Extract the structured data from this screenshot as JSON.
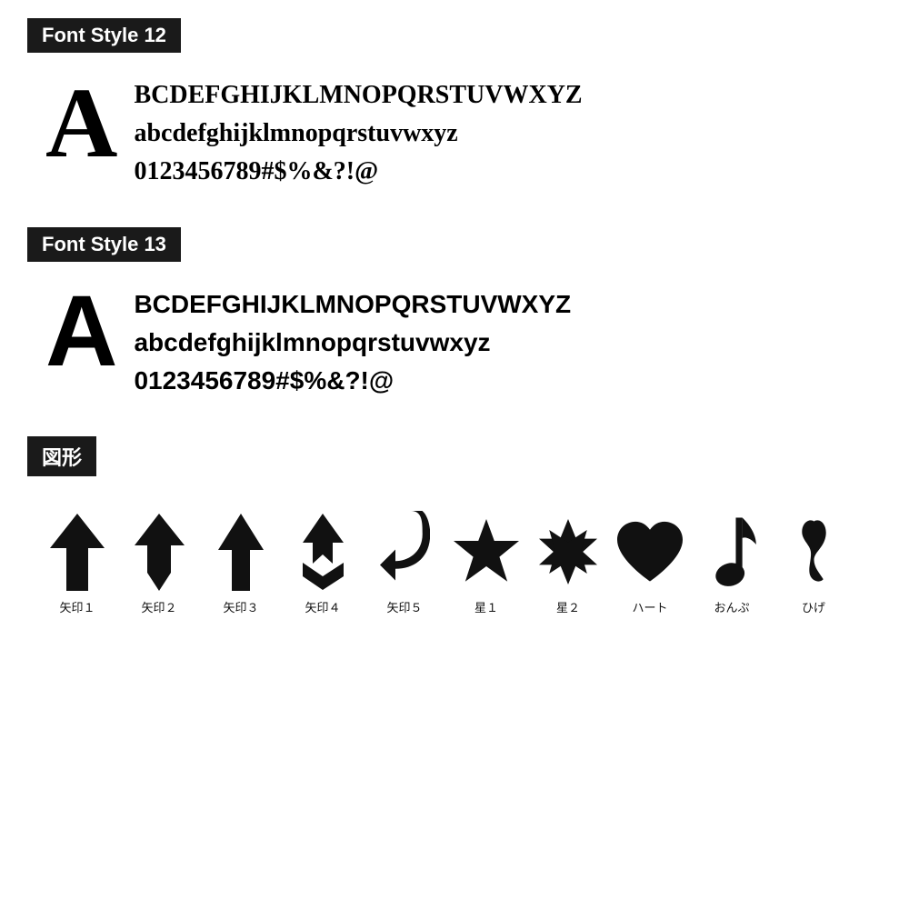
{
  "sections": [
    {
      "id": "font-style-12",
      "header": "Font Style 12",
      "big_letter": "A",
      "lines": [
        "BCDEFGHIJKLMNOPQRSTUVWXYZ",
        "abcdefghijklmnopqrstuvwxyz",
        "0123456789#$%&?!@"
      ],
      "font_type": "serif"
    },
    {
      "id": "font-style-13",
      "header": "Font Style 13",
      "big_letter": "A",
      "lines": [
        "BCDEFGHIJKLMNOPQRSTUVWXYZ",
        "abcdefghijklmnopqrstuvwxyz",
        "0123456789#$%&?!@"
      ],
      "font_type": "sans-serif"
    }
  ],
  "shapes_section": {
    "header": "図形",
    "items": [
      {
        "label": "矢印１"
      },
      {
        "label": "矢印２"
      },
      {
        "label": "矢印３"
      },
      {
        "label": "矢印４"
      },
      {
        "label": "矢印５"
      },
      {
        "label": "星１"
      },
      {
        "label": "星２"
      },
      {
        "label": "ハート"
      },
      {
        "label": "おんぷ"
      },
      {
        "label": "ひげ"
      }
    ]
  }
}
